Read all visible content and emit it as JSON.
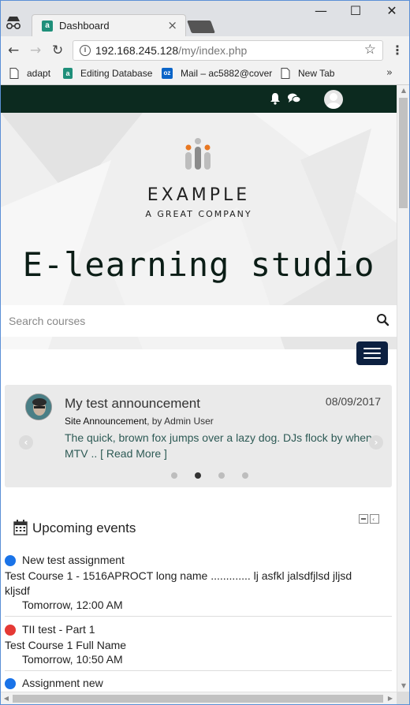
{
  "browser": {
    "tab_title": "Dashboard",
    "tab_close": "×",
    "window_controls": {
      "minimize": "—",
      "maximize": "☐",
      "close": "✕"
    },
    "url_host": "192.168.245.128",
    "url_path": "/my/index.php",
    "bookmarks": [
      "adapt",
      "Editing Database",
      "Mail – ac5882@cover",
      "New Tab"
    ],
    "bookmarks_more": "»",
    "nav": {
      "back": "←",
      "forward": "→",
      "reload": "↻",
      "star": "☆",
      "menu": "⋮"
    }
  },
  "site": {
    "logo_main": "EXAMPLE",
    "logo_sub": "A GREAT COMPANY",
    "title": "E-learning studio",
    "search_placeholder": "Search courses"
  },
  "announcement": {
    "title": "My test announcement",
    "date": "08/09/2017",
    "forum": "Site Announcement",
    "by": ", by Admin User",
    "body": "The quick, brown fox jumps over a lazy dog. DJs flock by when MTV .. ",
    "read_more": "[ Read More ]",
    "prev": "‹",
    "next": "›",
    "slides": 4,
    "active_slide": 2
  },
  "events_block": {
    "heading": "Upcoming events",
    "events": [
      {
        "name": "New test assignment",
        "course": "Test Course 1 - 1516APROCT long name ............. lj asfkl jalsdfjlsd jljsd kljsdf",
        "time": "Tomorrow, 12:00 AM",
        "color": "#1a73e8"
      },
      {
        "name": "TII test - Part 1",
        "course": "Test Course 1 Full Name",
        "time": "Tomorrow, 10:50 AM",
        "color": "#e53935"
      },
      {
        "name": "Assignment new",
        "course": "",
        "time": "",
        "color": "#1a73e8"
      }
    ]
  },
  "colors": {
    "navbar": "#0c2a1f",
    "hamburger": "#0c2040",
    "link": "#2d5a55"
  }
}
